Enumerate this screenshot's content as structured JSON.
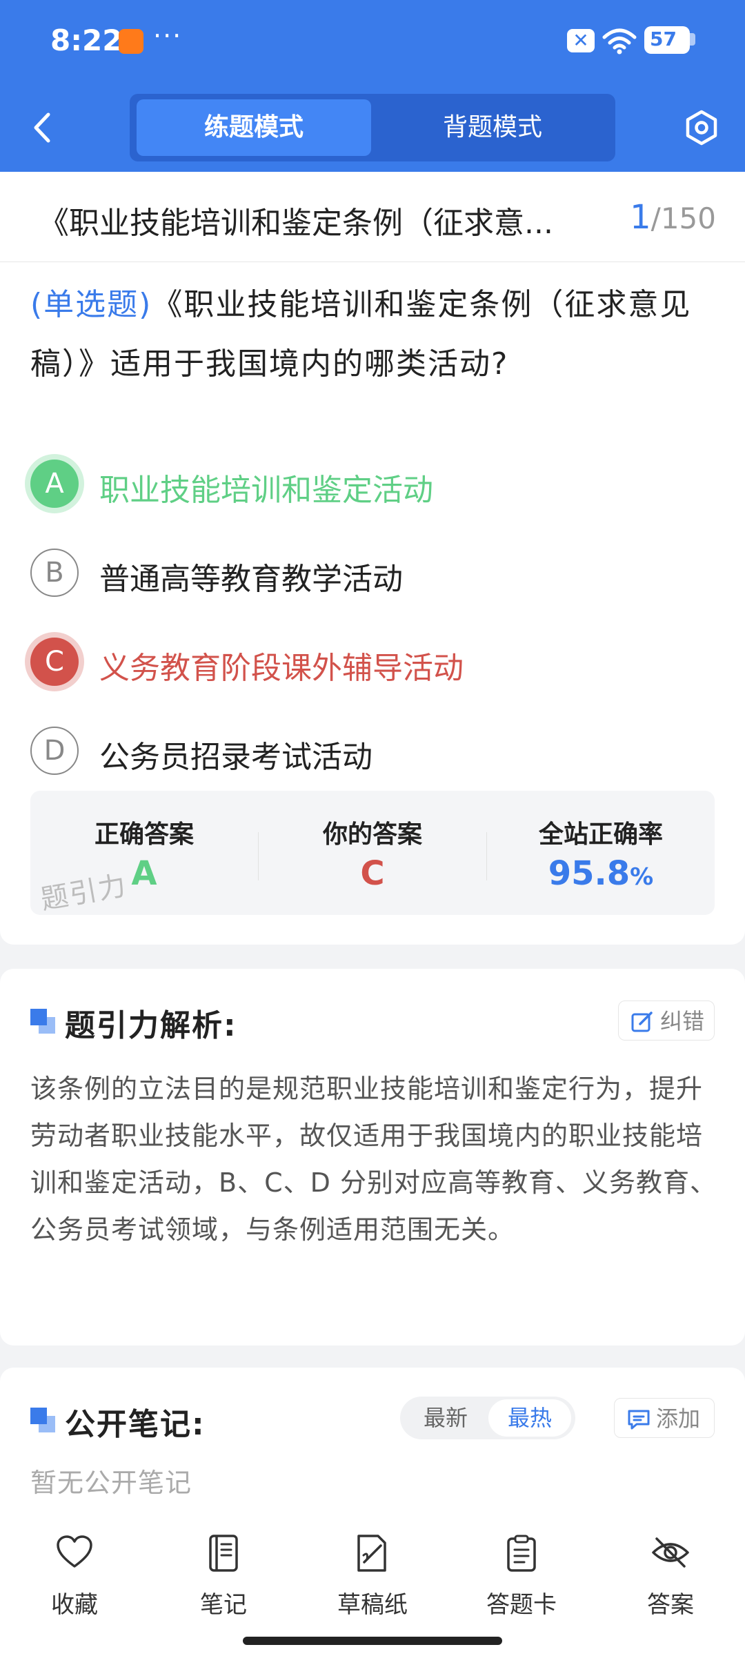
{
  "status_bar": {
    "time": "8:22",
    "more": "···",
    "sim": "✕",
    "battery": "57"
  },
  "header": {
    "back_icon": "chevron-left-icon",
    "modes": [
      "练题模式",
      "背题模式"
    ],
    "active_mode": 0,
    "settings_icon": "hexagon-gear-icon"
  },
  "exam": {
    "title": "《职业技能培训和鉴定条例（征求意...",
    "progress_current": "1",
    "progress_total": "/150"
  },
  "question": {
    "type_label": "(单选题)",
    "text": "《职业技能培训和鉴定条例（征求意见稿）》适用于我国境内的哪类活动?",
    "options": [
      {
        "letter": "A",
        "text": "职业技能培训和鉴定活动",
        "state": "correct"
      },
      {
        "letter": "B",
        "text": "普通高等教育教学活动",
        "state": "normal"
      },
      {
        "letter": "C",
        "text": "义务教育阶段课外辅导活动",
        "state": "wrong"
      },
      {
        "letter": "D",
        "text": "公务员招录考试活动",
        "state": "normal"
      }
    ]
  },
  "answer_summary": {
    "correct_label": "正确答案",
    "correct_value": "A",
    "yours_label": "你的答案",
    "yours_value": "C",
    "rate_label": "全站正确率",
    "rate_value": "95.8",
    "rate_unit": "%",
    "watermark": "题引力"
  },
  "analysis": {
    "title": "题引力解析:",
    "report_label": "纠错",
    "text": "该条例的立法目的是规范职业技能培训和鉴定行为，提升劳动者职业技能水平，故仅适用于我国境内的职业技能培训和鉴定活动，B、C、D 分别对应高等教育、义务教育、公务员考试领域，与条例适用范围无关。"
  },
  "notes": {
    "title": "公开笔记:",
    "sort_latest": "最新",
    "sort_hot": "最热",
    "add_label": "添加",
    "empty_text": "暂无公开笔记"
  },
  "toolbar": [
    {
      "label": "收藏",
      "icon": "heart-icon"
    },
    {
      "label": "笔记",
      "icon": "notebook-icon"
    },
    {
      "label": "草稿纸",
      "icon": "draft-paper-icon"
    },
    {
      "label": "答题卡",
      "icon": "answer-sheet-icon"
    },
    {
      "label": "答案",
      "icon": "eye-off-icon"
    }
  ],
  "colors": {
    "brand": "#3a7bea",
    "correct": "#5fcf85",
    "wrong": "#d2524b"
  }
}
